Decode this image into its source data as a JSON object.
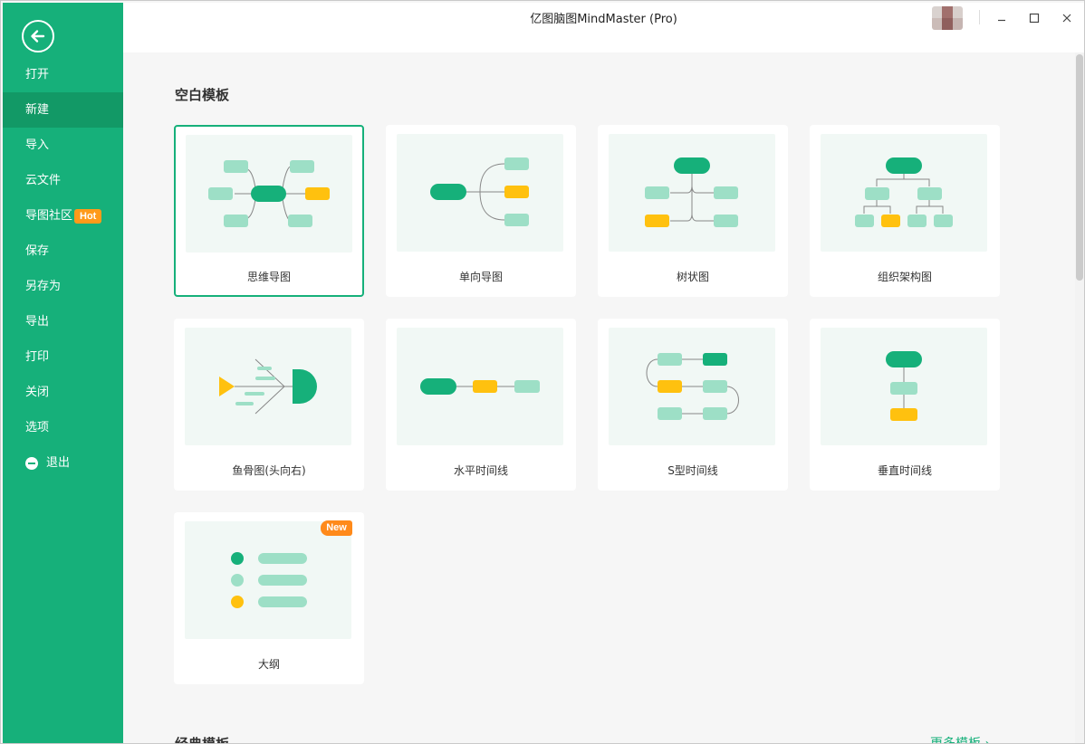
{
  "window": {
    "title": "亿图脑图MindMaster (Pro)"
  },
  "sidebar": {
    "items": [
      {
        "label": "打开"
      },
      {
        "label": "新建",
        "active": true
      },
      {
        "label": "导入"
      },
      {
        "label": "云文件"
      },
      {
        "label": "导图社区",
        "badge": "Hot"
      },
      {
        "label": "保存"
      },
      {
        "label": "另存为"
      },
      {
        "label": "导出"
      },
      {
        "label": "打印"
      },
      {
        "label": "关闭"
      },
      {
        "label": "选项"
      },
      {
        "label": "退出",
        "icon": "minus-circle-icon"
      }
    ]
  },
  "blank_templates": {
    "title": "空白模板",
    "cards": [
      {
        "label": "思维导图",
        "selected": true
      },
      {
        "label": "单向导图"
      },
      {
        "label": "树状图"
      },
      {
        "label": "组织架构图"
      },
      {
        "label": "鱼骨图(头向右)"
      },
      {
        "label": "水平时间线"
      },
      {
        "label": "S型时间线"
      },
      {
        "label": "垂直时间线"
      },
      {
        "label": "大纲",
        "badge": "New"
      }
    ]
  },
  "classic_templates": {
    "title": "经典模板",
    "more_link": "更多模板 ›"
  },
  "colors": {
    "brand": "#16b07a",
    "light": "#9ddfc6",
    "accent": "#ffc10f",
    "hot": "#ff9a1a"
  }
}
